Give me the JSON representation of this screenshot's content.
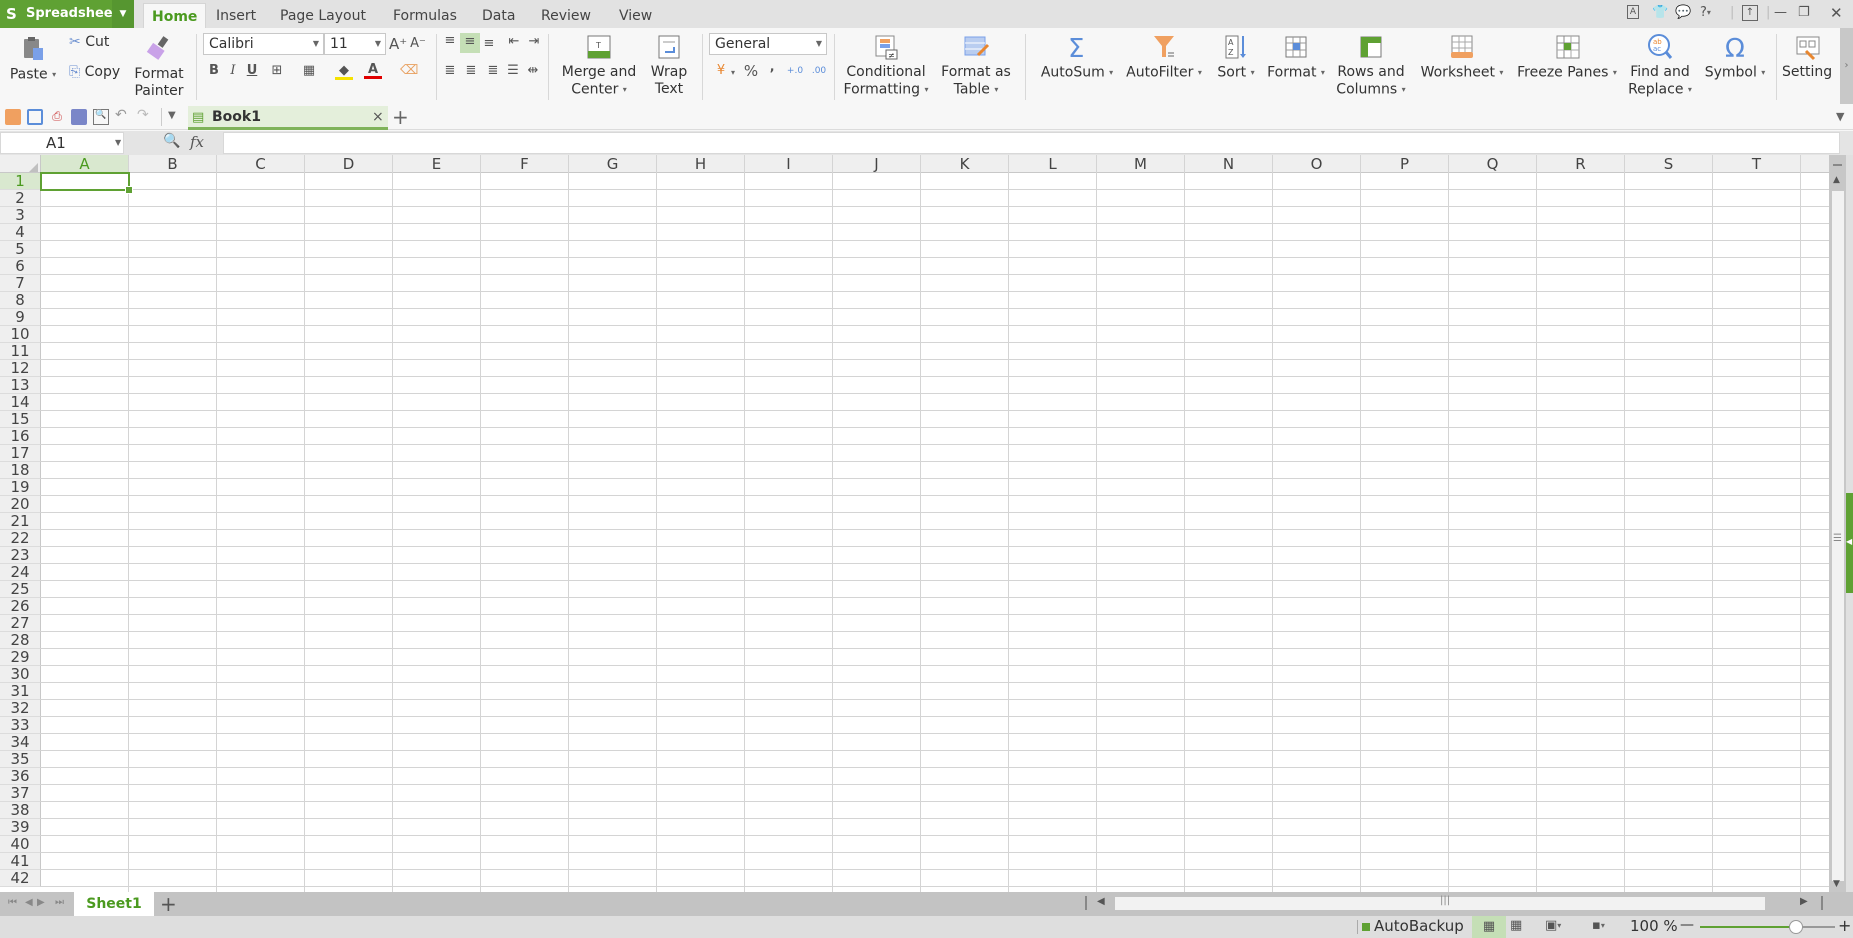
{
  "app": {
    "brand": "Spreadsheets",
    "brand_color": "#5fa133",
    "accent": "#4b9a1f"
  },
  "menu_tabs": [
    {
      "label": "Home",
      "active": true
    },
    {
      "label": "Insert"
    },
    {
      "label": "Page Layout"
    },
    {
      "label": "Formulas"
    },
    {
      "label": "Data"
    },
    {
      "label": "Review"
    },
    {
      "label": "View"
    }
  ],
  "window_controls": {
    "help": "?",
    "minimize": "—",
    "restore": "❐",
    "close": "✕"
  },
  "ribbon": {
    "paste": "Paste",
    "cut": "Cut",
    "copy": "Copy",
    "format_painter": [
      "Format",
      "Painter"
    ],
    "font_name": "Calibri",
    "font_size": "11",
    "bold": "B",
    "italic": "I",
    "underline": "U",
    "merge_center": [
      "Merge and",
      "Center"
    ],
    "wrap_text": [
      "Wrap",
      "Text"
    ],
    "number_format": "General",
    "percent": "%",
    "comma": "‚",
    "conditional_formatting": [
      "Conditional",
      "Formatting"
    ],
    "format_as_table": [
      "Format as",
      "Table"
    ],
    "autosum": "AutoSum",
    "autofilter": "AutoFilter",
    "sort": "Sort",
    "format": "Format",
    "rows_columns": [
      "Rows and",
      "Columns"
    ],
    "worksheet": "Worksheet",
    "freeze_panes": "Freeze Panes",
    "find_replace": [
      "Find and",
      "Replace"
    ],
    "symbol": "Symbol",
    "settings": "Setting"
  },
  "document_tab": {
    "label": "Book1",
    "close": "×",
    "new_tab": "+"
  },
  "formula_bar": {
    "name_box": "A1",
    "fx": "fx",
    "value": ""
  },
  "grid": {
    "columns": [
      "A",
      "B",
      "C",
      "D",
      "E",
      "F",
      "G",
      "H",
      "I",
      "J",
      "K",
      "L",
      "M",
      "N",
      "O",
      "P",
      "Q",
      "R",
      "S",
      "T"
    ],
    "rows": [
      "1",
      "2",
      "3",
      "4",
      "5",
      "6",
      "7",
      "8",
      "9",
      "10",
      "11",
      "12",
      "13",
      "14",
      "15",
      "16",
      "17",
      "18",
      "19",
      "20",
      "21",
      "22",
      "23",
      "24",
      "25",
      "26",
      "27",
      "28",
      "29",
      "30",
      "31",
      "32",
      "33",
      "34",
      "35",
      "36",
      "37",
      "38",
      "39",
      "40",
      "41",
      "42"
    ],
    "selected_cell": "A1"
  },
  "sheets": {
    "tabs": [
      "Sheet1"
    ],
    "active": "Sheet1",
    "add": "+"
  },
  "status": {
    "autobackup": "AutoBackup",
    "zoom": "100 %",
    "zoom_minus": "—",
    "zoom_plus": "+",
    "zoom_level_percent": 100
  }
}
